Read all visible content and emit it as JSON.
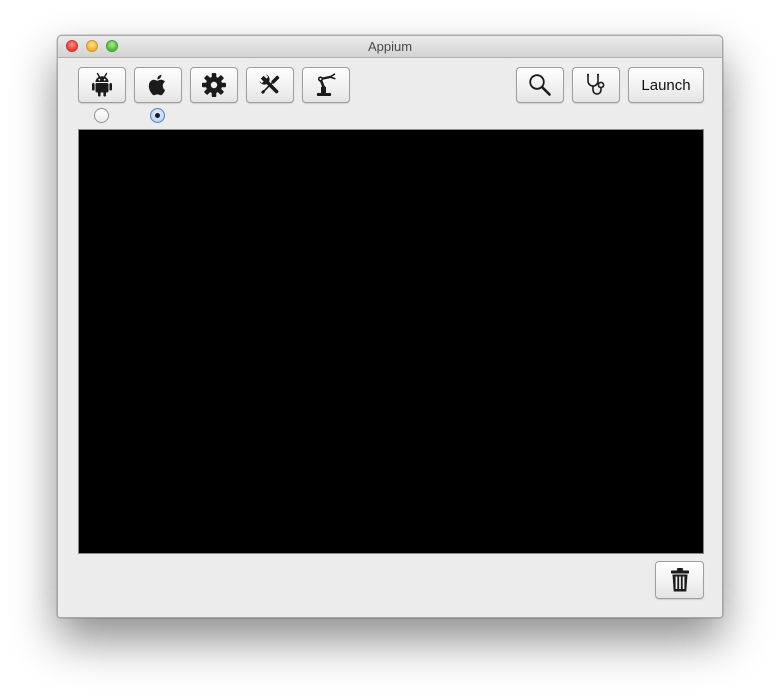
{
  "window": {
    "title": "Appium"
  },
  "toolbar": {
    "left_buttons": [
      {
        "name": "android-settings",
        "icon": "android-icon"
      },
      {
        "name": "ios-settings",
        "icon": "apple-icon"
      },
      {
        "name": "general-settings",
        "icon": "gear-icon"
      },
      {
        "name": "developer-settings",
        "icon": "tools-icon"
      },
      {
        "name": "robot-settings",
        "icon": "robot-arm-icon"
      }
    ],
    "platform_radios": [
      {
        "platform": "android",
        "selected": false
      },
      {
        "platform": "ios",
        "selected": true
      }
    ],
    "right_buttons": [
      {
        "name": "inspector",
        "icon": "magnifier-icon"
      },
      {
        "name": "doctor",
        "icon": "stethoscope-icon"
      }
    ],
    "launch_label": "Launch"
  },
  "log": {
    "text": ""
  },
  "footer": {
    "clear_log_icon": "trash-icon"
  },
  "colors": {
    "window_bg": "#ececec",
    "log_bg": "#000000",
    "selected_radio": "#bcd3f4"
  }
}
